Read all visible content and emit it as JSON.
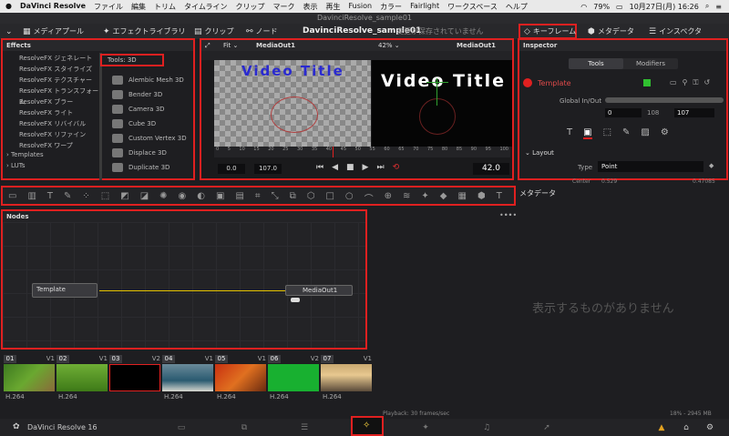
{
  "mac_menu": {
    "apple": "",
    "items": [
      "DaVinci Resolve",
      "ファイル",
      "編集",
      "トリム",
      "タイムライン",
      "クリップ",
      "マーク",
      "表示",
      "再生",
      "Fusion",
      "カラー",
      "Fairlight",
      "ワークスペース",
      "ヘルプ"
    ],
    "battery": "79%",
    "datetime": "10月27日(月)  16:26"
  },
  "window_title": "DavinciResolve_sample01",
  "toolbar": {
    "media_pool": "メディアプール",
    "effects_library": "エフェクトライブラリ",
    "clips": "クリップ",
    "nodes": "ノード",
    "project_name": "DavinciResolve_sample01",
    "unsaved": "変更が保存されていません",
    "keyframes": "キーフレーム",
    "metadata": "メタデータ",
    "inspector": "インスペクタ"
  },
  "effects": {
    "title": "Effects",
    "list": [
      "ResolveFX ジェネレート",
      "ResolveFX スタイライズ",
      "ResolveFX テクスチャー",
      "ResolveFX トランスフォーム",
      "ResolveFX ブラー",
      "ResolveFX ライト",
      "ResolveFX リバイバル",
      "ResolveFX リファイン",
      "ResolveFX ワープ"
    ],
    "templates": "Templates",
    "luts": "LUTs",
    "tools_header": "Tools: 3D",
    "tools": [
      "Alembic Mesh 3D",
      "Bender 3D",
      "Camera 3D",
      "Cube 3D",
      "Custom Vertex 3D",
      "Displace 3D",
      "Duplicate 3D"
    ]
  },
  "viewer": {
    "fit": "Fit",
    "left_name": "MediaOut1",
    "zoom": "42%",
    "right_name": "MediaOut1",
    "video_title_left": "Video Title",
    "video_title_right": "Video Title",
    "ruler": [
      "0",
      "5",
      "10",
      "15",
      "20",
      "25",
      "30",
      "35",
      "40",
      "45",
      "50",
      "55",
      "60",
      "65",
      "70",
      "75",
      "80",
      "85",
      "90",
      "95",
      "100"
    ],
    "in_time": "0.0",
    "out_time": "107.0",
    "current_time": "42.0"
  },
  "inspector": {
    "title": "Inspector",
    "tab_tools": "Tools",
    "tab_modifiers": "Modifiers",
    "node_name": "Template",
    "global_inout_label": "Global In/Out",
    "global_in": "0",
    "global_mid": "108",
    "global_out": "107",
    "section_layout": "Layout",
    "type_label": "Type",
    "type_value": "Point",
    "center_label": "Center",
    "center_x": "0.529",
    "center_y": "0.47085"
  },
  "metadata": {
    "title": "メタデータ",
    "empty": "表示するものがありません"
  },
  "nodes": {
    "title": "Nodes",
    "template_node": "Template",
    "media_out_node": "MediaOut1"
  },
  "clips": [
    {
      "num": "01",
      "track": "V1",
      "format": "H.264",
      "kind": "rabbit"
    },
    {
      "num": "02",
      "track": "V1",
      "format": "H.264",
      "kind": "grass"
    },
    {
      "num": "03",
      "track": "V2",
      "format": "",
      "kind": "black"
    },
    {
      "num": "04",
      "track": "V1",
      "format": "H.264",
      "kind": "wave"
    },
    {
      "num": "05",
      "track": "V1",
      "format": "H.264",
      "kind": "autumn"
    },
    {
      "num": "06",
      "track": "V2",
      "format": "H.264",
      "kind": "green"
    },
    {
      "num": "07",
      "track": "V1",
      "format": "H.264",
      "kind": "sea"
    }
  ],
  "status": {
    "playback": "Playback: 30 frames/sec",
    "memory": "18% - 2945 MB"
  },
  "app_name": "DaVinci Resolve 16",
  "colors": {
    "accent_red": "#e02020",
    "panel": "#1e1e21",
    "viewer_title_blue": "#2a2ad0"
  }
}
